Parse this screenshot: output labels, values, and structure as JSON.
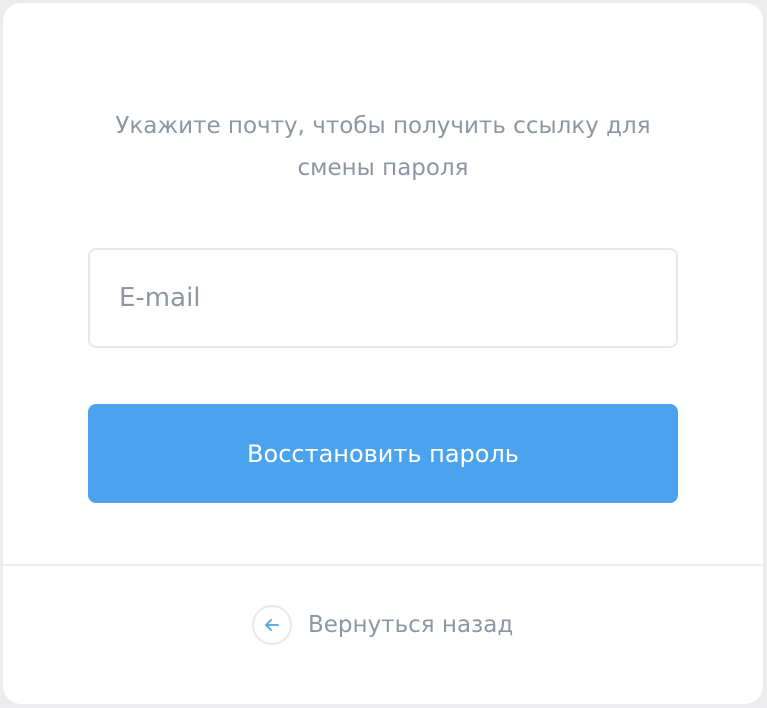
{
  "instruction": {
    "line1": "Укажите почту, чтобы получить ссылку для",
    "line2": "смены пароля"
  },
  "email_field": {
    "placeholder": "E-mail",
    "value": ""
  },
  "submit_button": {
    "label": "Восстановить пароль"
  },
  "back_link": {
    "label": "Вернуться назад",
    "icon": "arrow-left-icon"
  },
  "colors": {
    "accent": "#4aa3ec",
    "muted_text": "#8f95a3",
    "border": "#e7e8ec"
  }
}
